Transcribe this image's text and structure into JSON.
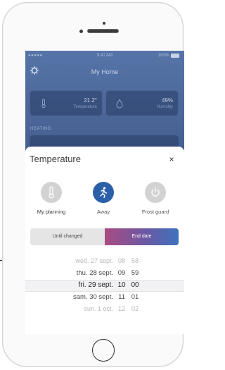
{
  "status_bar": {
    "carrier": "●●●●● ",
    "time": "9:41 AM",
    "battery": "100%"
  },
  "app": {
    "title": "My Home",
    "tiles": [
      {
        "value": "21.2°",
        "label": "Temperature",
        "icon": "thermometer-icon"
      },
      {
        "value": "49%",
        "label": "Humidity",
        "icon": "droplet-icon"
      }
    ],
    "section_label": "HEATING"
  },
  "sheet": {
    "title": "Temperature",
    "close": "×",
    "modes": [
      {
        "label": "My planning",
        "icon": "thermometer-icon",
        "selected": false
      },
      {
        "label": "Away",
        "icon": "running-person-icon",
        "selected": true
      },
      {
        "label": "Frost guard",
        "icon": "power-icon",
        "selected": false
      }
    ],
    "segment": {
      "left": "Until changed",
      "right": "End date",
      "active": "right"
    },
    "picker": {
      "rows": [
        {
          "date": "wed. 27 sept.",
          "hour": "08",
          "min": "58"
        },
        {
          "date": "thu. 28 sept.",
          "hour": "09",
          "min": "59"
        },
        {
          "date": "fri. 29 sept.",
          "hour": "10",
          "min": "00"
        },
        {
          "date": "sam. 30 sept.",
          "hour": "11",
          "min": "01"
        },
        {
          "date": "sun. 1 oct.",
          "hour": "12",
          "min": "02"
        }
      ],
      "selected_index": 2
    }
  },
  "colors": {
    "accent": "#2b5fa8",
    "segment_gradient_start": "#a94c82",
    "segment_gradient_end": "#3f72bd"
  }
}
